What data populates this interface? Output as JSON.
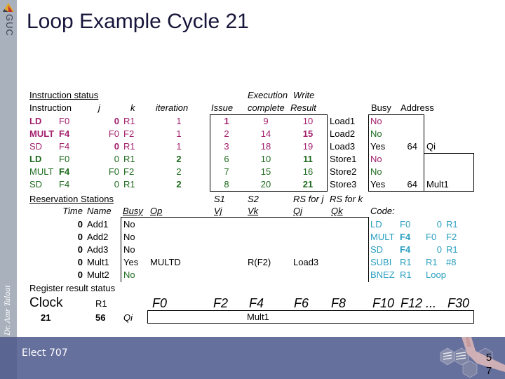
{
  "slide": {
    "title": "Loop Example Cycle 21",
    "logo_text": "GUC",
    "author": "Dr. Amr Talaat",
    "course": "Elect 707",
    "page_number": [
      "5",
      "7"
    ]
  },
  "instruction_status": {
    "heading": "Instruction status",
    "headers": {
      "instruction": "Instruction",
      "j": "j",
      "k": "k",
      "iteration": "iteration",
      "issue": "Issue",
      "exec_top": "Execution",
      "exec_bottom": "complete",
      "write_top": "Write",
      "write_bottom": "Result"
    },
    "rows": [
      {
        "op": "LD",
        "dest": "F0",
        "j": "0",
        "k": "R1",
        "iteration": "1",
        "issue": "1",
        "exec": "9",
        "write": "10",
        "color": "mag"
      },
      {
        "op": "MULT",
        "dest": "F4",
        "j": "F0",
        "k": "F2",
        "iteration": "1",
        "issue": "2",
        "exec": "14",
        "write": "15",
        "color": "mag"
      },
      {
        "op": "SD",
        "dest": "F4",
        "j": "0",
        "k": "R1",
        "iteration": "1",
        "issue": "3",
        "exec": "18",
        "write": "19",
        "color": "mag"
      },
      {
        "op": "LD",
        "dest": "F0",
        "j": "0",
        "k": "R1",
        "iteration": "2",
        "issue": "6",
        "exec": "10",
        "write": "11",
        "color": "grn"
      },
      {
        "op": "MULT",
        "dest": "F4",
        "j": "F0",
        "k": "F2",
        "iteration": "2",
        "issue": "7",
        "exec": "15",
        "write": "16",
        "color": "grn"
      },
      {
        "op": "SD",
        "dest": "F4",
        "j": "0",
        "k": "R1",
        "iteration": "2",
        "issue": "8",
        "exec": "20",
        "write": "21",
        "color": "grn"
      }
    ]
  },
  "load_store_buffers": {
    "headers": {
      "busy": "Busy",
      "address": "Address"
    },
    "rows": [
      {
        "name": "Load1",
        "busy": "No",
        "address": "",
        "qi": "",
        "color": "mag"
      },
      {
        "name": "Load2",
        "busy": "No",
        "address": "",
        "qi": "",
        "color": "grn"
      },
      {
        "name": "Load3",
        "busy": "Yes",
        "address": "64",
        "qi": "Qi",
        "color": ""
      },
      {
        "name": "Store1",
        "busy": "No",
        "address": "",
        "qi": "",
        "color": "mag"
      },
      {
        "name": "Store2",
        "busy": "No",
        "address": "",
        "qi": "",
        "color": "grn"
      },
      {
        "name": "Store3",
        "busy": "Yes",
        "address": "64",
        "qi": "Mult1",
        "color": ""
      }
    ]
  },
  "reservation_stations": {
    "heading": "Reservation Stations",
    "headers": {
      "time": "Time",
      "name": "Name",
      "busy": "Busy",
      "op": "Op",
      "s1": "S1",
      "s2": "S2",
      "rs_j": "RS for j",
      "rs_k": "RS for k",
      "vj": "Vj",
      "vk": "Vk",
      "qj": "Qj",
      "qk": "Qk"
    },
    "rows": [
      {
        "time": "0",
        "name": "Add1",
        "busy": "No",
        "op": "",
        "vj": "",
        "vk": "",
        "qj": "",
        "qk": "",
        "color": ""
      },
      {
        "time": "0",
        "name": "Add2",
        "busy": "No",
        "op": "",
        "vj": "",
        "vk": "",
        "qj": "",
        "qk": "",
        "color": ""
      },
      {
        "time": "0",
        "name": "Add3",
        "busy": "No",
        "op": "",
        "vj": "",
        "vk": "",
        "qj": "",
        "qk": "",
        "color": ""
      },
      {
        "time": "0",
        "name": "Mult1",
        "busy": "Yes",
        "op": "MULTD",
        "vj": "",
        "vk": "R(F2)",
        "qj": "Load3",
        "qk": "",
        "color": ""
      },
      {
        "time": "0",
        "name": "Mult2",
        "busy": "No",
        "op": "",
        "vj": "",
        "vk": "",
        "qj": "",
        "qk": "",
        "color": "grn"
      }
    ]
  },
  "code": {
    "heading": "Code:",
    "lines": [
      {
        "op": "LD",
        "a": "F0",
        "b": "0",
        "c": "R1"
      },
      {
        "op": "MULT",
        "a": "F4",
        "b": "F0",
        "c": "F2"
      },
      {
        "op": "SD",
        "a": "F4",
        "b": "0",
        "c": "R1"
      },
      {
        "op": "SUBI",
        "a": "R1",
        "b": "R1",
        "c": "#8"
      },
      {
        "op": "BNEZ",
        "a": "R1",
        "b": "Loop",
        "c": ""
      }
    ]
  },
  "register_status": {
    "heading": "Register result status",
    "clock_label": "Clock",
    "clock_value": "21",
    "r1_label": "R1",
    "r1_value": "56",
    "qi_label": "Qi",
    "registers": [
      {
        "name": "F0",
        "qi": ""
      },
      {
        "name": "F2",
        "qi": ""
      },
      {
        "name": "F4",
        "qi": "Mult1"
      },
      {
        "name": "F6",
        "qi": ""
      },
      {
        "name": "F8",
        "qi": ""
      },
      {
        "name": "F10",
        "qi": ""
      },
      {
        "name": "F12 ...",
        "qi": ""
      },
      {
        "name": "F30",
        "qi": ""
      }
    ]
  }
}
